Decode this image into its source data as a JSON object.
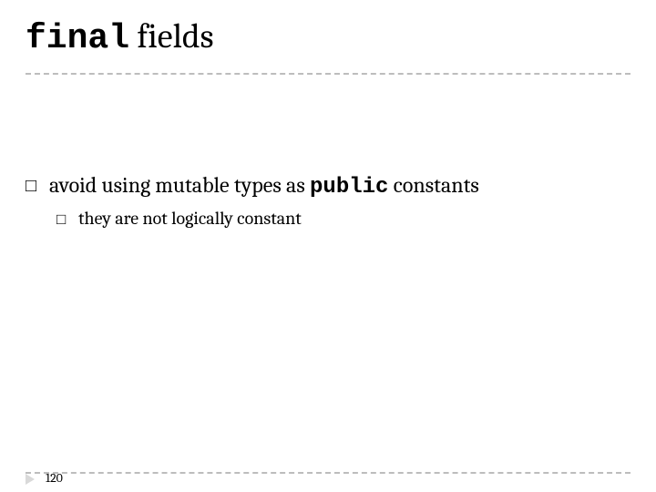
{
  "title": {
    "mono": "final",
    "rest": " fields"
  },
  "bullets": {
    "level1": {
      "pre": "avoid using mutable types as ",
      "mono": "public",
      "post": " constants"
    },
    "level2": {
      "text": "they are not logically constant"
    }
  },
  "pageNumber": "120",
  "markers": {
    "square": "□"
  }
}
